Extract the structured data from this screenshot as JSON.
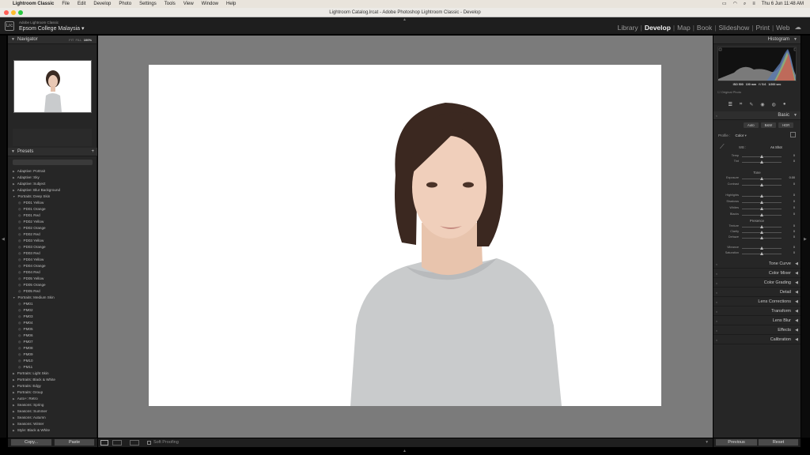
{
  "mac_menu": {
    "app_name": "Lightroom Classic",
    "items": [
      "File",
      "Edit",
      "Develop",
      "Photo",
      "Settings",
      "Tools",
      "View",
      "Window",
      "Help"
    ],
    "clock": "Thu 6 Jun  11:48 AM"
  },
  "window_title": "Lightroom Catalog.lrcat - Adobe Photoshop Lightroom Classic - Develop",
  "identity": {
    "subtitle": "Adobe Lightroom Classic",
    "catalog_name": "Epsom College Malaysia",
    "logo": "Lrc"
  },
  "modules": [
    "Library",
    "Develop",
    "Map",
    "Book",
    "Slideshow",
    "Print",
    "Web"
  ],
  "active_module": "Develop",
  "navigator": {
    "title": "Navigator",
    "zoom_options": [
      "FIT",
      "FILL",
      "100%"
    ],
    "active_zoom": "100%"
  },
  "presets": {
    "title": "Presets",
    "items": [
      {
        "label": "Adaptive: Portrait",
        "level": 0,
        "open": false
      },
      {
        "label": "Adaptive: Sky",
        "level": 0,
        "open": false
      },
      {
        "label": "Adaptive: Subject",
        "level": 0,
        "open": false
      },
      {
        "label": "Adaptive: Blur Background",
        "level": 0,
        "open": false
      },
      {
        "label": "Portraits: Deep Skin",
        "level": 0,
        "open": true
      },
      {
        "label": "PD01 Yellow",
        "level": 1
      },
      {
        "label": "PD01 Orange",
        "level": 1
      },
      {
        "label": "PD01 Red",
        "level": 1
      },
      {
        "label": "PD02 Yellow",
        "level": 1
      },
      {
        "label": "PD02 Orange",
        "level": 1
      },
      {
        "label": "PD02 Red",
        "level": 1
      },
      {
        "label": "PD03 Yellow",
        "level": 1
      },
      {
        "label": "PD03 Orange",
        "level": 1
      },
      {
        "label": "PD03 Red",
        "level": 1
      },
      {
        "label": "PD04 Yellow",
        "level": 1
      },
      {
        "label": "PD04 Orange",
        "level": 1
      },
      {
        "label": "PD04 Red",
        "level": 1
      },
      {
        "label": "PD05 Yellow",
        "level": 1
      },
      {
        "label": "PD05 Orange",
        "level": 1
      },
      {
        "label": "PD05 Red",
        "level": 1
      },
      {
        "label": "Portraits: Medium Skin",
        "level": 0,
        "open": true
      },
      {
        "label": "PM01",
        "level": 1
      },
      {
        "label": "PM02",
        "level": 1
      },
      {
        "label": "PM03",
        "level": 1
      },
      {
        "label": "PM04",
        "level": 1
      },
      {
        "label": "PM05",
        "level": 1
      },
      {
        "label": "PM06",
        "level": 1
      },
      {
        "label": "PM07",
        "level": 1
      },
      {
        "label": "PM08",
        "level": 1
      },
      {
        "label": "PM09",
        "level": 1
      },
      {
        "label": "PM10",
        "level": 1
      },
      {
        "label": "PM11",
        "level": 1
      },
      {
        "label": "Portraits: Light Skin",
        "level": 0,
        "open": false
      },
      {
        "label": "Portraits: Black & White",
        "level": 0,
        "open": false
      },
      {
        "label": "Portraits: Edgy",
        "level": 0,
        "open": false
      },
      {
        "label": "Portraits: Group",
        "level": 0,
        "open": false
      },
      {
        "label": "Auto+: Retro",
        "level": 0,
        "open": false
      },
      {
        "label": "Seasons: Spring",
        "level": 0,
        "open": false
      },
      {
        "label": "Seasons: Summer",
        "level": 0,
        "open": false
      },
      {
        "label": "Seasons: Autumn",
        "level": 0,
        "open": false
      },
      {
        "label": "Seasons: Winter",
        "level": 0,
        "open": false
      },
      {
        "label": "Style: Black & White",
        "level": 0,
        "open": false
      }
    ]
  },
  "left_buttons": {
    "copy": "Copy...",
    "paste": "Paste"
  },
  "toolbar": {
    "soft_proofing": "Soft Proofing"
  },
  "histogram": {
    "title": "Histogram",
    "values": [
      "ISO 500",
      "100 mm",
      "f / 5.6",
      "1/200 sec"
    ],
    "original_photo": "Original Photo"
  },
  "basic": {
    "title": "Basic",
    "tags": [
      "Auto",
      "B&W",
      "HDR"
    ],
    "profile_label": "Profile :",
    "profile_value": "Color",
    "wb_label": "WB :",
    "wb_value": "As Shot",
    "tone_label": "Tone",
    "presence_label": "Presence",
    "wb_sliders": [
      {
        "label": "Temp",
        "value": "0",
        "pos": 0.5
      },
      {
        "label": "Tint",
        "value": "0",
        "pos": 0.5
      }
    ],
    "tone_sliders": [
      {
        "label": "Exposure",
        "value": "0.00",
        "pos": 0.5
      },
      {
        "label": "Contrast",
        "value": "0",
        "pos": 0.5
      },
      {
        "label": "Highlights",
        "value": "0",
        "pos": 0.5
      },
      {
        "label": "Shadows",
        "value": "0",
        "pos": 0.5
      },
      {
        "label": "Whites",
        "value": "0",
        "pos": 0.5
      },
      {
        "label": "Blacks",
        "value": "0",
        "pos": 0.5
      }
    ],
    "presence_sliders": [
      {
        "label": "Texture",
        "value": "0",
        "pos": 0.5
      },
      {
        "label": "Clarity",
        "value": "0",
        "pos": 0.5
      },
      {
        "label": "Dehaze",
        "value": "0",
        "pos": 0.5
      },
      {
        "label": "Vibrance",
        "value": "0",
        "pos": 0.5
      },
      {
        "label": "Saturation",
        "value": "0",
        "pos": 0.5
      }
    ]
  },
  "collapsed_panels": [
    "Tone Curve",
    "Color Mixer",
    "Color Grading",
    "Detail",
    "Lens Corrections",
    "Transform",
    "Lens Blur",
    "Effects",
    "Calibration"
  ],
  "right_buttons": {
    "previous": "Previous",
    "reset": "Reset"
  },
  "colors": {
    "accent": "#f0f0f0",
    "panel": "#262626",
    "canvas": "#7b7b7b"
  }
}
